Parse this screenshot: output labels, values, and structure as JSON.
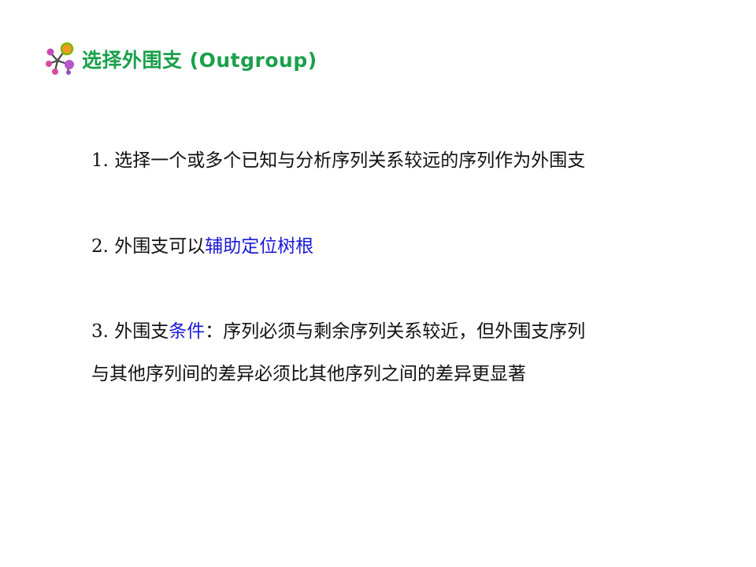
{
  "colors": {
    "title": "#1aa04a",
    "text": "#111111",
    "highlight": "#1a1ad6"
  },
  "title": "选择外围支 (Outgroup)",
  "logo": {
    "icon": "molecule-icon"
  },
  "items": [
    {
      "number": "1.",
      "text": "选择一个或多个已知与分析序列关系较远的序列作为外围支"
    },
    {
      "number": "2.",
      "text_before": "外围支可以",
      "highlight": "辅助定位树根"
    },
    {
      "number": "3.",
      "text_before": "外围支",
      "highlight": "条件",
      "line1_rest": "：序列必须与剩余序列关系较近，但外围支序列",
      "line2": "与其他序列间的差异必须比其他序列之间的差异更显著"
    }
  ]
}
